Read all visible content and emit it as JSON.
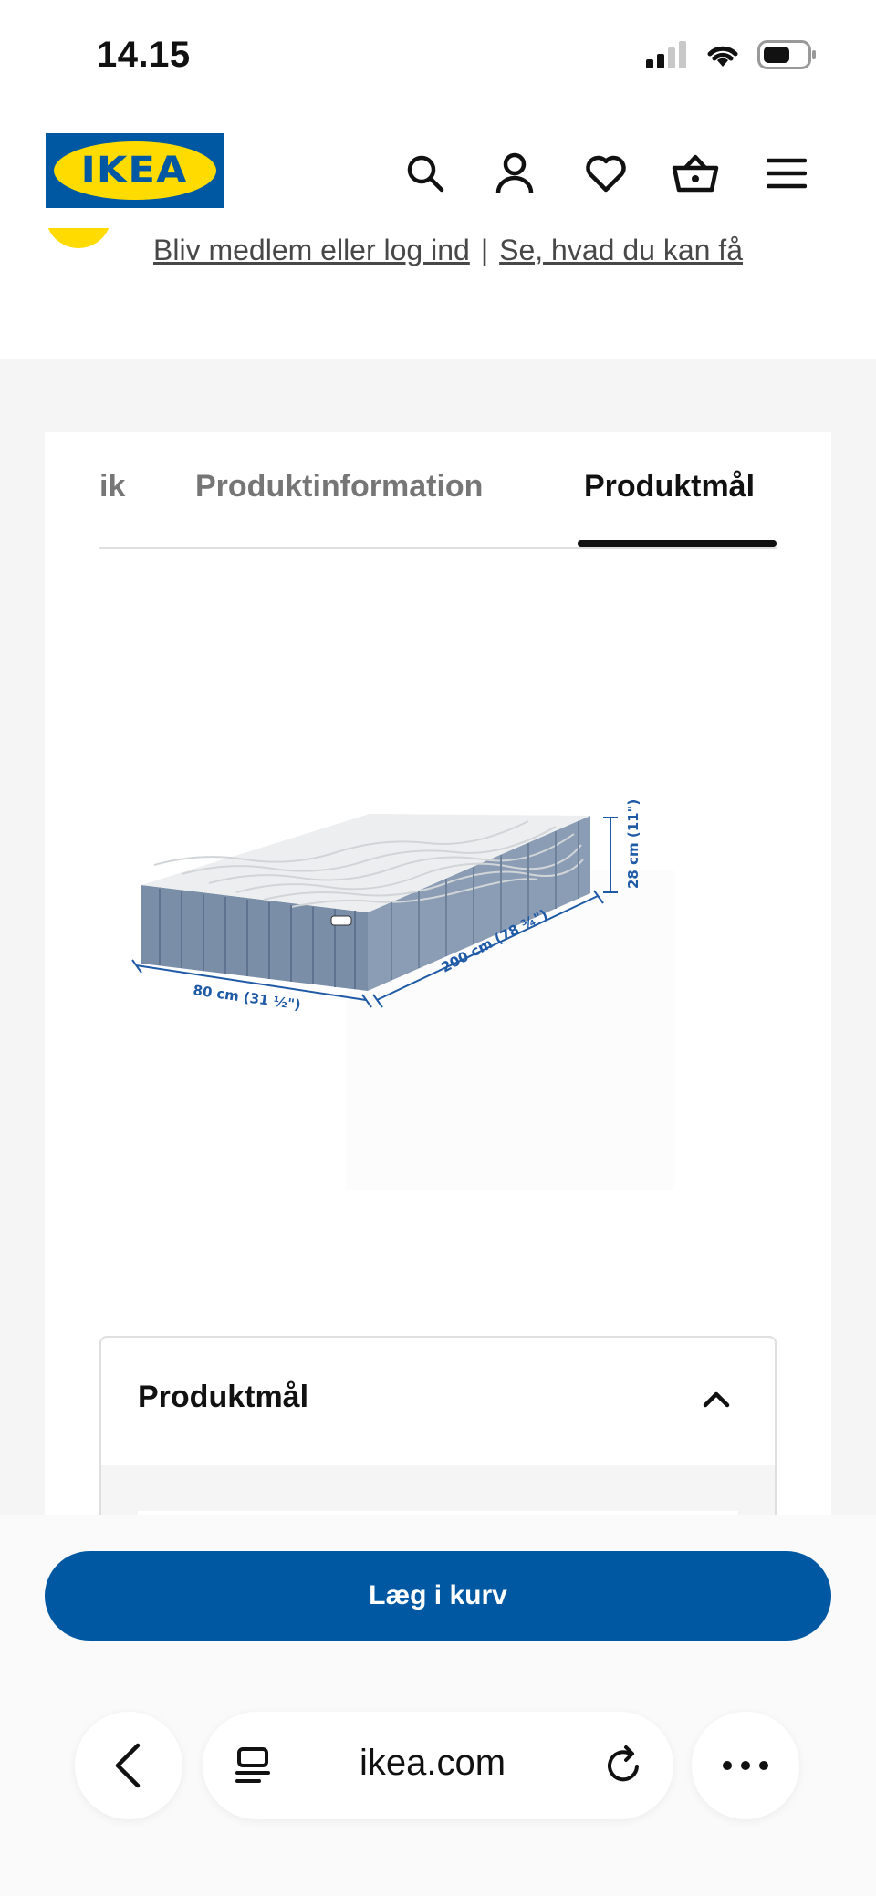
{
  "status_bar": {
    "time": "14.15"
  },
  "header": {
    "logo_text": "IKEA",
    "icons": [
      "search-icon",
      "profile-icon",
      "heart-icon",
      "basket-icon",
      "menu-icon"
    ]
  },
  "member": {
    "link_join": "Bliv medlem eller log ind",
    "separator": "|",
    "link_benefits": "Se, hvad du kan få"
  },
  "tabs": {
    "partial": "ik",
    "product_information": "Produktinformation",
    "product_dimensions": "Produktmål",
    "active": "Produktmål"
  },
  "illustration": {
    "width_label": "80 cm (31 ½\")",
    "length_label": "200 cm (78 ¾\")",
    "height_label": "28 cm (11\")"
  },
  "accordion": {
    "title": "Produktmål",
    "expanded": true
  },
  "cart_button": {
    "label": "Læg i kurv",
    "color": "#0058a3"
  },
  "browser": {
    "url": "ikea.com"
  },
  "colors": {
    "ikea_blue": "#0058a3",
    "ikea_yellow": "#ffdb00",
    "background_grey": "#f5f5f5"
  }
}
